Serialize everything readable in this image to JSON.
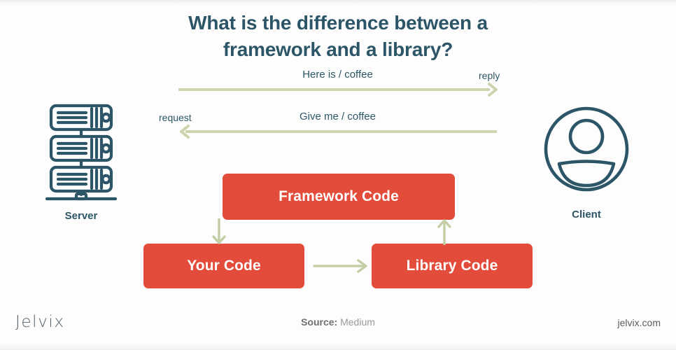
{
  "title": {
    "line1": "What is the difference between a",
    "line2": "framework and a library?"
  },
  "colors": {
    "title_teal": "#2c5667",
    "box_red": "#e34c3a",
    "arrow_sage": "#cfd3ae",
    "icon_teal": "#2c5667",
    "background": "#fdfdfd"
  },
  "endpoints": {
    "server": {
      "label": "Server",
      "icon": "server-rack-icon"
    },
    "client": {
      "label": "Client",
      "icon": "user-avatar-icon"
    }
  },
  "messages": {
    "reply": {
      "text": "Here is / coffee",
      "edge_label": "reply",
      "direction": "server-to-client"
    },
    "request": {
      "text": "Give me / coffee",
      "edge_label": "request",
      "direction": "client-to-server"
    }
  },
  "boxes": {
    "framework": "Framework Code",
    "your_code": "Your Code",
    "library": "Library Code"
  },
  "flows": {
    "framework_to_your_code": "arrow-down-icon",
    "library_to_framework": "arrow-up-icon",
    "your_code_to_library": "arrow-right-icon"
  },
  "footer": {
    "logo": "Jelvix",
    "source_key": "Source:",
    "source_value": "Medium",
    "website": "jelvix.com"
  }
}
